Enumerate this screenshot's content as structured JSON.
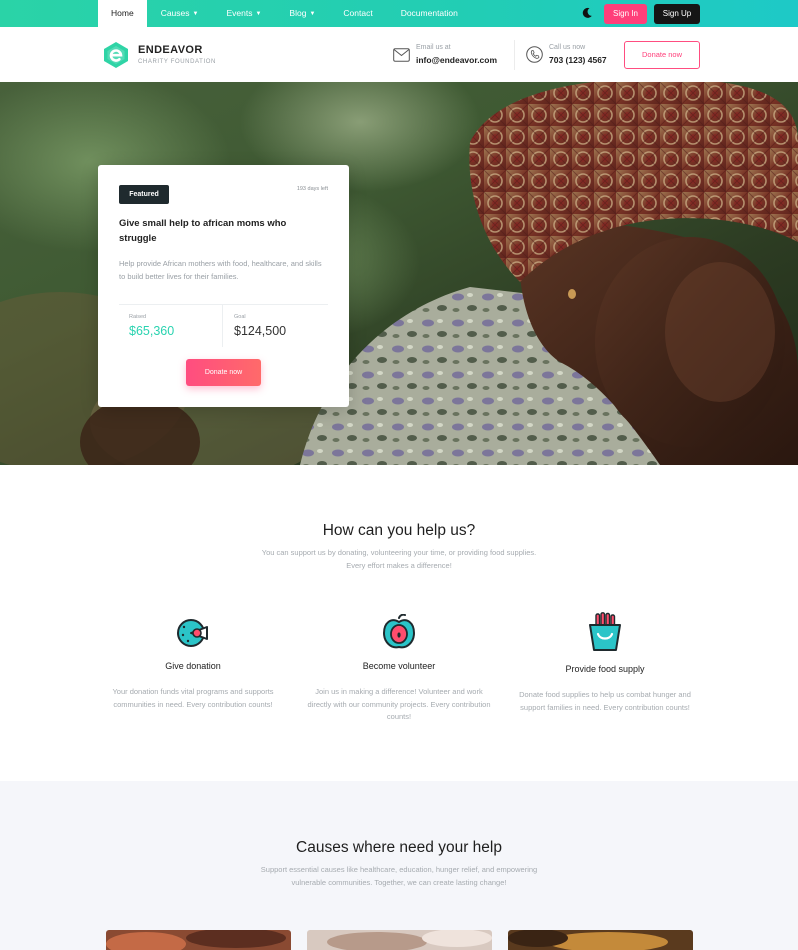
{
  "topbar": {
    "nav": [
      {
        "label": "Home",
        "active": true,
        "dropdown": false
      },
      {
        "label": "Causes",
        "active": false,
        "dropdown": true
      },
      {
        "label": "Events",
        "active": false,
        "dropdown": true
      },
      {
        "label": "Blog",
        "active": false,
        "dropdown": true
      },
      {
        "label": "Contact",
        "active": false,
        "dropdown": false
      },
      {
        "label": "Documentation",
        "active": false,
        "dropdown": false
      }
    ],
    "theme_icon": "moon-icon",
    "signin_label": "Sign In",
    "signup_label": "Sign Up",
    "gradient": [
      "#2ad3a7",
      "#1ec9c7"
    ]
  },
  "header": {
    "brand": "ENDEAVOR",
    "brand_sub": "CHARITY FOUNDATION",
    "email_label": "Email us at",
    "email_value": "info@endeavor.com",
    "phone_label": "Call us now",
    "phone_value": "703 (123) 4567",
    "donate_label": "Donate now"
  },
  "hero_card": {
    "badge": "Featured",
    "days_left": "193 days left",
    "title": "Give small help to african moms who struggle",
    "description": "Help provide African mothers with food, healthcare, and skills to build better lives for their families.",
    "raised_label": "Raised",
    "raised_value": "$65,360",
    "goal_label": "Goal",
    "goal_value": "$124,500",
    "donate_label": "Donate now"
  },
  "help": {
    "title": "How can you help us?",
    "subtitle_line1": "You can support us by donating, volunteering your time, or providing food supplies.",
    "subtitle_line2": "Every effort makes a difference!",
    "features": [
      {
        "icon": "donation-icon",
        "title": "Give donation",
        "desc": "Your donation funds vital programs and supports communities in need. Every contribution counts!"
      },
      {
        "icon": "apple-icon",
        "title": "Become volunteer",
        "desc": "Join us in making a difference! Volunteer and work directly with our community projects. Every contribution counts!"
      },
      {
        "icon": "food-icon",
        "title": "Provide food supply",
        "desc": "Donate food supplies to help us combat hunger and support families in need. Every contribution counts!"
      }
    ]
  },
  "causes": {
    "title": "Causes where need your help",
    "subtitle_line1": "Support essential causes like healthcare, education, hunger relief, and empowering",
    "subtitle_line2": "vulnerable communities. Together, we can create lasting change!"
  },
  "colors": {
    "accent": "#2ad3b0",
    "pink": "#ff3f7a",
    "dark": "#151515"
  }
}
